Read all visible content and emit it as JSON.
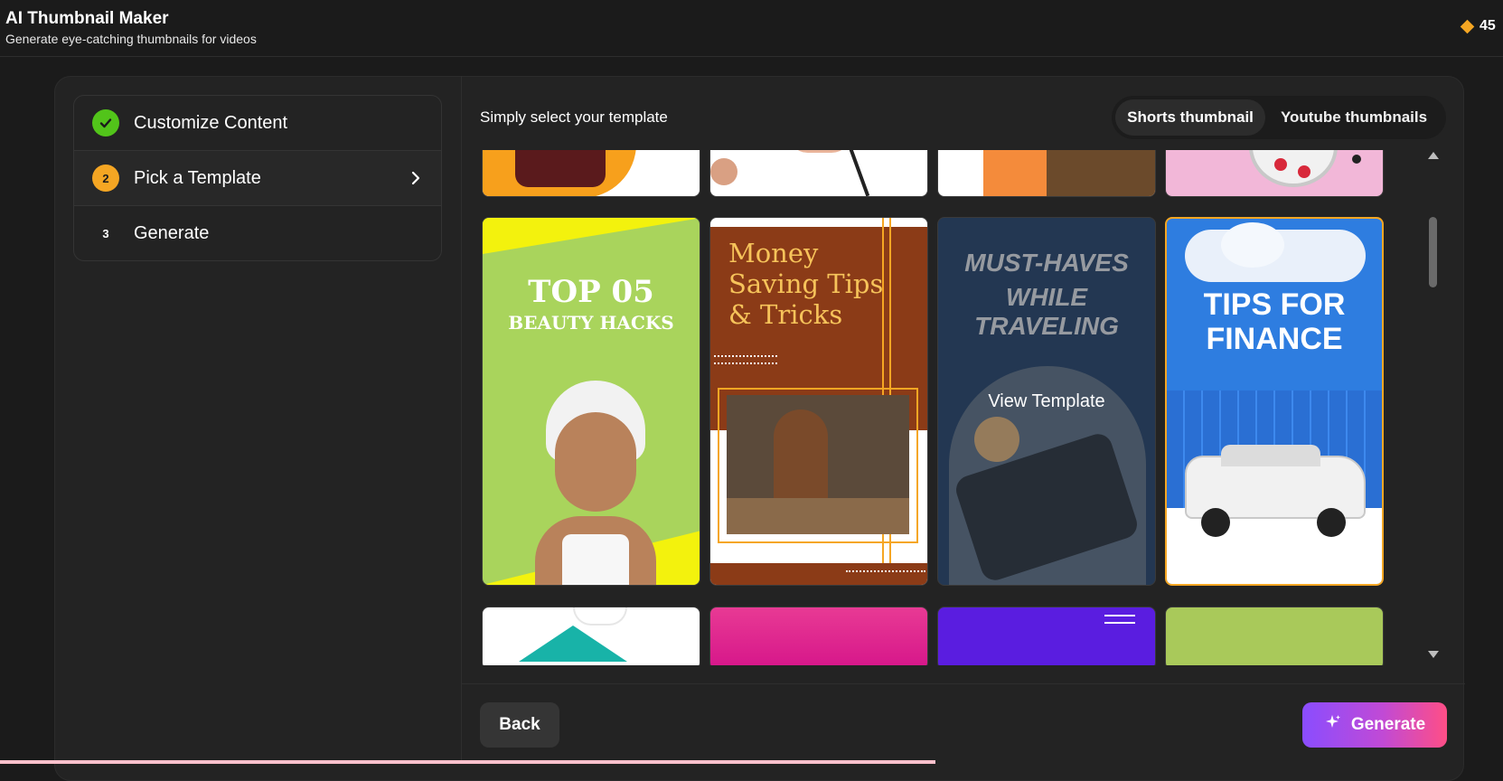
{
  "header": {
    "title": "AI Thumbnail Maker",
    "subtitle": "Generate eye-catching thumbnails for videos",
    "credits": "45"
  },
  "steps": [
    {
      "number": "",
      "label": "Customize Content",
      "state": "done"
    },
    {
      "number": "2",
      "label": "Pick a Template",
      "state": "current"
    },
    {
      "number": "3",
      "label": "Generate",
      "state": "pending"
    }
  ],
  "panel": {
    "heading": "Simply select your template",
    "tabs": [
      {
        "label": "Shorts thumbnail",
        "active": true
      },
      {
        "label": "Youtube thumbnails",
        "active": false
      }
    ]
  },
  "templates": {
    "beauty": {
      "line1": "TOP 05",
      "line2": "BEAUTY HACKS"
    },
    "money": {
      "line1": "Money",
      "line2": "Saving Tips",
      "line3": "& Tricks"
    },
    "travel": {
      "line1": "MUST-HAVES",
      "line2": "WHILE TRAVELING",
      "hover": "View Template"
    },
    "finance": {
      "line1": "TIPS FOR",
      "line2": "FINANCE"
    }
  },
  "footer": {
    "back_label": "Back",
    "generate_label": "Generate"
  },
  "colors": {
    "accent_orange": "#f5a623",
    "success_green": "#52c41a",
    "generate_gradient_start": "#8a4dff",
    "generate_gradient_end": "#ff4e86"
  }
}
